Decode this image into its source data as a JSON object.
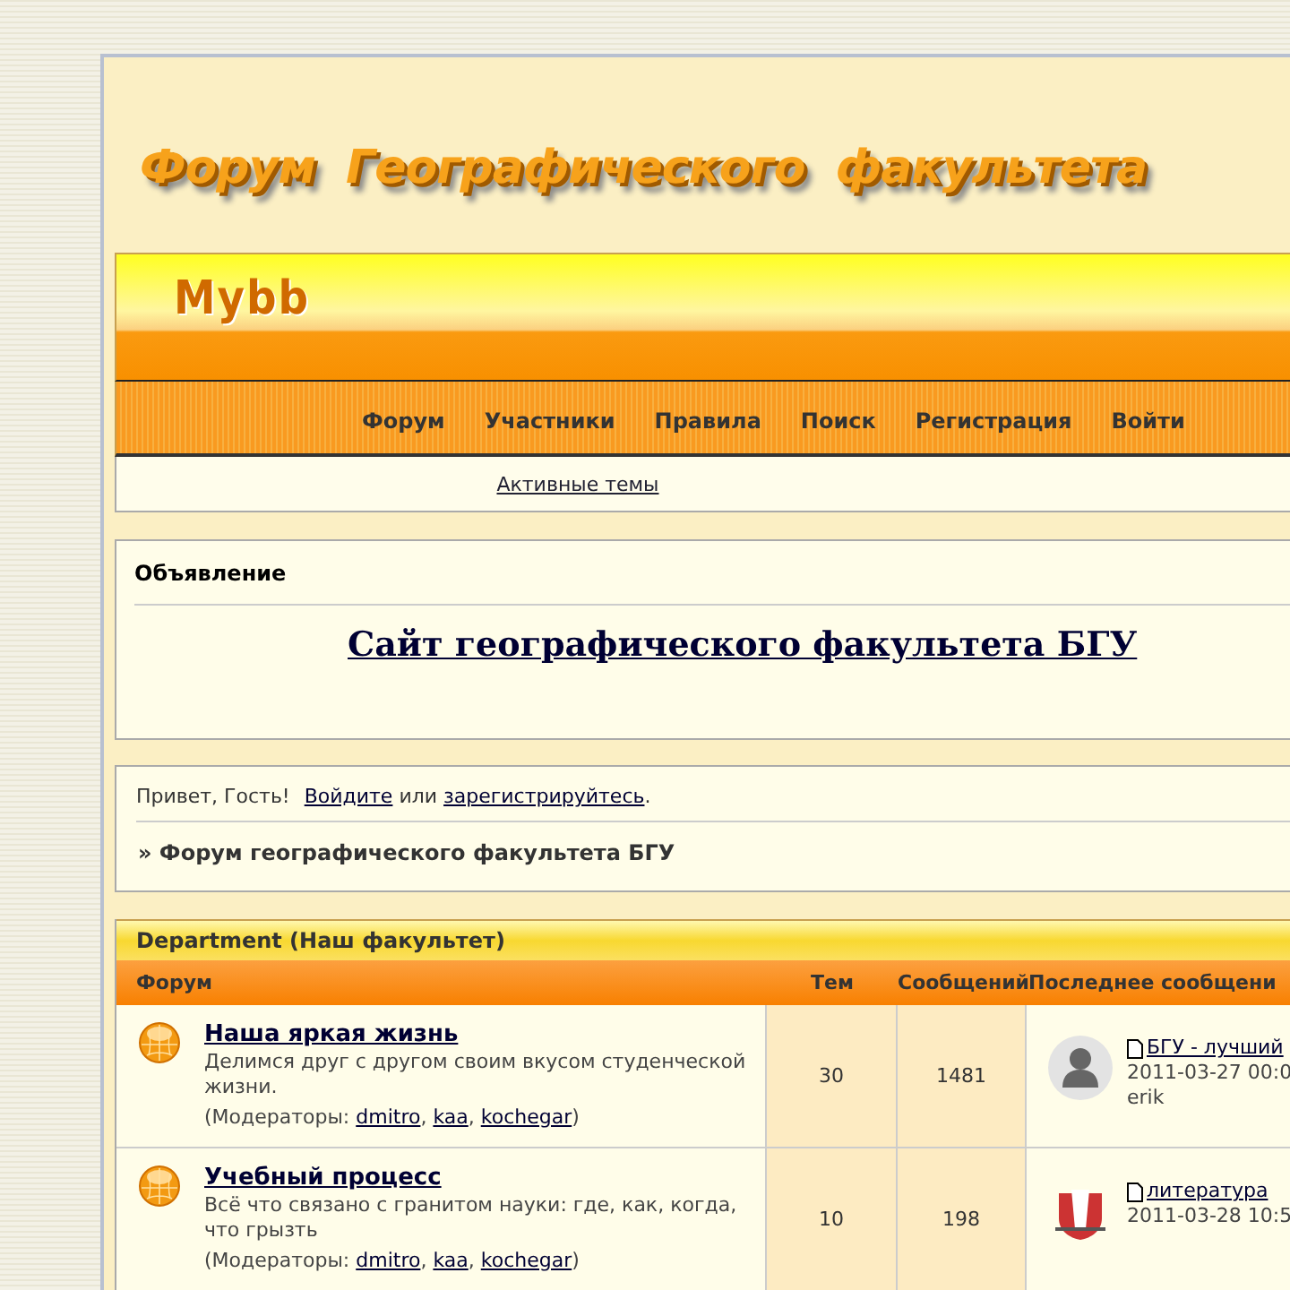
{
  "header": {
    "title": "Форум  Географического  факультета",
    "logo": "Mybb"
  },
  "nav": [
    {
      "label": "Форум"
    },
    {
      "label": "Участники"
    },
    {
      "label": "Правила"
    },
    {
      "label": "Поиск"
    },
    {
      "label": "Регистрация"
    },
    {
      "label": "Войти"
    }
  ],
  "subnav": {
    "link": "Активные темы"
  },
  "announcement": {
    "heading": "Объявление",
    "link": "Сайт географического факультета БГУ"
  },
  "welcome": {
    "greeting": "Привет, Гость!",
    "login": "Войдите",
    "or": "или",
    "register": "зарегистрируйтесь",
    "end": "."
  },
  "breadcrumb": "» Форум географического факультета БГУ",
  "category": {
    "title": "Department (Наш факультет)",
    "columns": [
      "Форум",
      "Тем",
      "Сообщений",
      "Последнее сообщени"
    ],
    "forums": [
      {
        "name": "Наша яркая жизнь",
        "description": "Делимся друг с другом своим вкусом студенческой жизни.",
        "moderators_label": "(Модераторы:",
        "moderators": [
          "dmitro",
          "kaa",
          "kochegar"
        ],
        "separator": ",",
        "moderators_end": ")",
        "threads": "30",
        "posts": "1481",
        "last_post": {
          "title": "БГУ - лучший",
          "date": "2011-03-27 00:0",
          "author": "erik",
          "kind": "silhouette"
        }
      },
      {
        "name": "Учебный процесс",
        "description": "Всё что связано с гранитом науки: где, как, когда, что грызть",
        "moderators_label": "(Модераторы:",
        "moderators": [
          "dmitro",
          "kaa",
          "kochegar"
        ],
        "separator": ",",
        "moderators_end": ")",
        "threads": "10",
        "posts": "198",
        "last_post": {
          "title": "литература",
          "date": "2011-03-28 10:5",
          "kind": "emblem"
        }
      }
    ]
  }
}
